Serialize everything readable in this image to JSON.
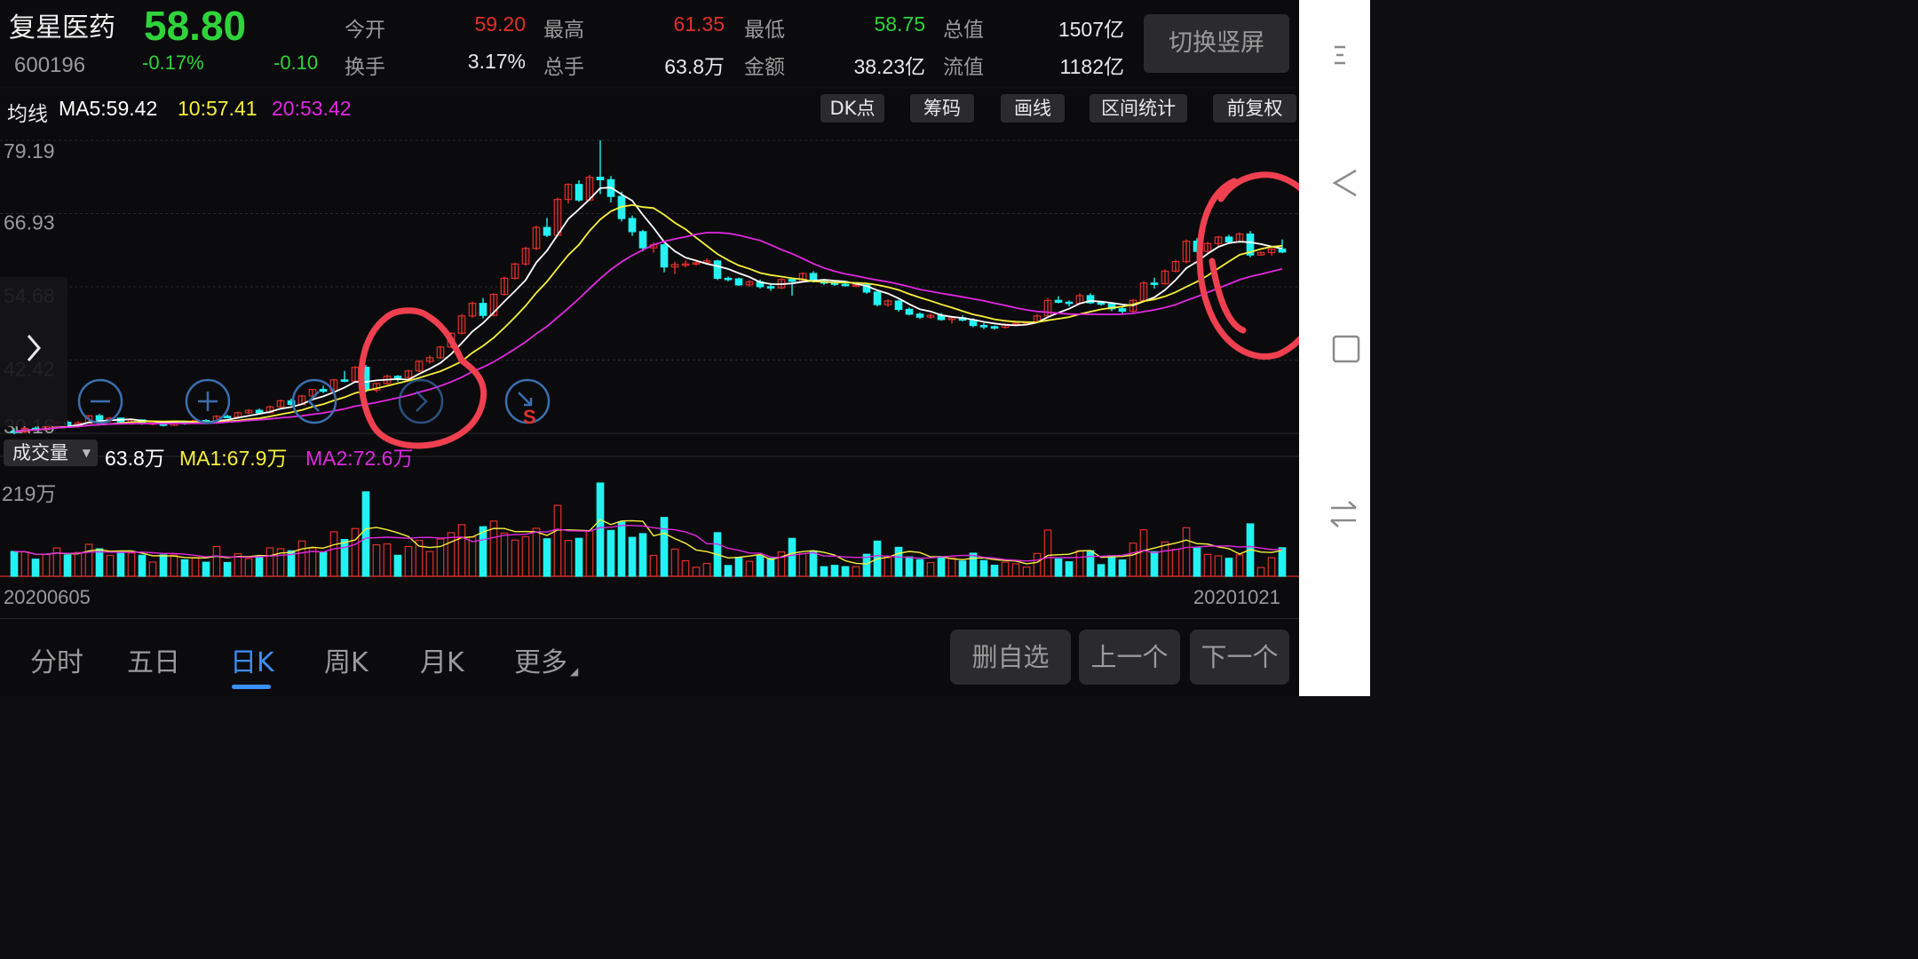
{
  "quote": {
    "name": "复星医药",
    "code": "600196",
    "price": "58.80",
    "pct_change": "-0.17%",
    "abs_change": "-0.10",
    "fields": [
      {
        "label": "今开",
        "value": "59.20",
        "color": "#e0302a"
      },
      {
        "label": "最高",
        "value": "61.35",
        "color": "#e0302a"
      },
      {
        "label": "最低",
        "value": "58.75",
        "color": "#2fd43b"
      },
      {
        "label": "总值",
        "value": "1507亿",
        "color": "#e8e8e8"
      },
      {
        "label": "换手",
        "value": "3.17%",
        "color": "#e8e8e8"
      },
      {
        "label": "总手",
        "value": "63.8万",
        "color": "#e8e8e8"
      },
      {
        "label": "金额",
        "value": "38.23亿",
        "color": "#e8e8e8"
      },
      {
        "label": "流值",
        "value": "1182亿",
        "color": "#e8e8e8"
      }
    ],
    "switch_label": "切换竖屏"
  },
  "ma_bar": {
    "label": "均线",
    "ma5": "MA5:59.42",
    "ma10": "10:57.41",
    "ma20": "20:53.42",
    "buttons": [
      "DK点",
      "筹码",
      "画线",
      "区间统计",
      "前复权"
    ]
  },
  "price_axis": [
    "79.19",
    "66.93",
    "54.68",
    "42.42",
    "30.16"
  ],
  "volume": {
    "selector": "成交量",
    "value": "63.8万",
    "ma1": "MA1:67.9万",
    "ma2": "MA2:72.6万",
    "axis_max": "219万"
  },
  "dates": {
    "start": "20200605",
    "end": "20201021"
  },
  "tabs": [
    "分时",
    "五日",
    "日K",
    "周K",
    "月K",
    "更多"
  ],
  "active_tab": "日K",
  "actions": [
    "删自选",
    "上一个",
    "下一个"
  ],
  "icons": [
    "expand-chevron-icon",
    "zoom-out-icon",
    "zoom-in-icon",
    "scroll-left-icon",
    "scroll-right-icon",
    "reset-icon",
    "menu-icon",
    "back-icon",
    "home-icon",
    "switch-app-icon"
  ],
  "colors": {
    "up": "#e0302a",
    "down": "#22f2f2",
    "ma5": "#ffffff",
    "ma10": "#f7f03a",
    "ma20": "#e028e0",
    "annotation": "#f04050"
  },
  "chart_data": {
    "type": "candlestick",
    "ylim": [
      30.16,
      79.19
    ],
    "candles": [
      [
        30.5,
        31.0,
        30.0,
        30.4
      ],
      [
        30.4,
        31.2,
        30.2,
        31.0
      ],
      [
        31.0,
        31.3,
        30.6,
        30.8
      ],
      [
        30.8,
        31.5,
        30.6,
        31.3
      ],
      [
        31.3,
        32.2,
        31.0,
        32.0
      ],
      [
        32.0,
        32.3,
        31.4,
        31.6
      ],
      [
        31.6,
        32.2,
        31.2,
        31.9
      ],
      [
        31.9,
        33.2,
        31.8,
        33.1
      ],
      [
        33.1,
        33.4,
        32.2,
        32.4
      ],
      [
        32.4,
        32.9,
        32.0,
        32.7
      ],
      [
        32.7,
        32.8,
        31.8,
        32.0
      ],
      [
        32.0,
        32.6,
        31.6,
        32.4
      ],
      [
        32.4,
        32.5,
        31.6,
        31.8
      ],
      [
        31.8,
        32.1,
        31.5,
        31.9
      ],
      [
        31.9,
        32.2,
        31.3,
        31.5
      ],
      [
        31.5,
        32.3,
        31.4,
        32.1
      ],
      [
        32.1,
        32.3,
        31.6,
        31.8
      ],
      [
        31.8,
        32.5,
        31.7,
        32.3
      ],
      [
        32.3,
        32.5,
        31.9,
        32.0
      ],
      [
        32.0,
        33.2,
        31.9,
        33.0
      ],
      [
        33.0,
        33.3,
        32.7,
        32.9
      ],
      [
        32.9,
        33.8,
        32.8,
        33.6
      ],
      [
        33.6,
        34.2,
        33.4,
        34.0
      ],
      [
        34.0,
        34.3,
        33.4,
        33.6
      ],
      [
        33.6,
        34.8,
        33.5,
        34.6
      ],
      [
        34.6,
        35.8,
        34.5,
        35.6
      ],
      [
        35.6,
        36.0,
        34.8,
        35.0
      ],
      [
        35.0,
        36.6,
        34.9,
        36.4
      ],
      [
        36.4,
        37.6,
        36.2,
        37.5
      ],
      [
        37.5,
        38.1,
        36.9,
        37.2
      ],
      [
        37.2,
        39.3,
        37.0,
        39.1
      ],
      [
        39.1,
        40.6,
        38.7,
        38.9
      ],
      [
        38.9,
        41.4,
        38.8,
        41.2
      ],
      [
        41.2,
        41.6,
        37.0,
        37.4
      ],
      [
        37.4,
        38.6,
        37.0,
        38.5
      ],
      [
        38.5,
        40.0,
        38.3,
        39.7
      ],
      [
        39.7,
        39.9,
        38.8,
        39.5
      ],
      [
        39.5,
        40.8,
        39.2,
        40.6
      ],
      [
        40.6,
        42.4,
        40.4,
        42.2
      ],
      [
        42.2,
        43.2,
        41.8,
        42.8
      ],
      [
        42.8,
        44.8,
        42.6,
        44.6
      ],
      [
        44.6,
        47.1,
        44.4,
        46.9
      ],
      [
        46.9,
        50.1,
        46.7,
        49.8
      ],
      [
        49.8,
        52.2,
        49.5,
        51.9
      ],
      [
        51.9,
        52.8,
        49.4,
        49.9
      ],
      [
        49.9,
        53.6,
        49.7,
        53.4
      ],
      [
        53.4,
        56.4,
        53.2,
        56.1
      ],
      [
        56.1,
        58.7,
        55.9,
        58.5
      ],
      [
        58.5,
        61.4,
        58.2,
        61.1
      ],
      [
        61.1,
        64.9,
        60.8,
        64.6
      ],
      [
        64.6,
        66.2,
        63.0,
        63.3
      ],
      [
        63.3,
        69.6,
        63.1,
        69.3
      ],
      [
        69.3,
        72.0,
        68.6,
        71.8
      ],
      [
        71.8,
        72.5,
        68.9,
        69.2
      ],
      [
        69.2,
        73.4,
        69.0,
        73.0
      ],
      [
        73.0,
        79.2,
        70.2,
        72.6
      ],
      [
        72.6,
        73.2,
        68.8,
        69.8
      ],
      [
        69.8,
        70.6,
        65.6,
        66.1
      ],
      [
        66.1,
        66.6,
        63.2,
        63.9
      ],
      [
        63.9,
        64.2,
        60.6,
        61.2
      ],
      [
        61.2,
        62.1,
        60.4,
        61.7
      ],
      [
        61.7,
        61.9,
        57.1,
        58.0
      ],
      [
        58.0,
        58.9,
        56.8,
        58.4
      ],
      [
        58.4,
        59.1,
        57.9,
        58.5
      ],
      [
        58.5,
        58.9,
        58.2,
        58.7
      ],
      [
        58.7,
        59.4,
        58.4,
        59.0
      ],
      [
        59.0,
        59.2,
        55.8,
        56.1
      ],
      [
        56.1,
        56.4,
        55.6,
        56.0
      ],
      [
        56.0,
        56.2,
        54.8,
        55.0
      ],
      [
        55.0,
        55.8,
        54.7,
        55.5
      ],
      [
        55.5,
        55.9,
        54.4,
        54.7
      ],
      [
        54.7,
        55.3,
        54.0,
        54.5
      ],
      [
        54.5,
        56.1,
        54.3,
        55.9
      ],
      [
        55.9,
        56.0,
        53.2,
        55.6
      ],
      [
        55.6,
        57.1,
        55.4,
        56.9
      ],
      [
        56.9,
        57.3,
        55.4,
        55.6
      ],
      [
        55.6,
        55.7,
        55.0,
        55.3
      ],
      [
        55.3,
        55.6,
        54.8,
        55.1
      ],
      [
        55.1,
        55.4,
        54.7,
        54.9
      ],
      [
        54.9,
        55.3,
        54.6,
        55.0
      ],
      [
        55.0,
        55.1,
        53.5,
        53.8
      ],
      [
        53.8,
        53.9,
        51.4,
        51.7
      ],
      [
        51.7,
        52.6,
        51.3,
        52.3
      ],
      [
        52.3,
        52.5,
        50.5,
        50.9
      ],
      [
        50.9,
        51.2,
        49.9,
        50.1
      ],
      [
        50.1,
        50.4,
        49.3,
        49.6
      ],
      [
        49.6,
        50.2,
        49.3,
        49.9
      ],
      [
        49.9,
        50.3,
        49.0,
        49.2
      ],
      [
        49.2,
        49.7,
        48.5,
        49.5
      ],
      [
        49.5,
        49.9,
        48.9,
        49.1
      ],
      [
        49.1,
        49.4,
        47.9,
        48.2
      ],
      [
        48.2,
        48.6,
        47.6,
        48.0
      ],
      [
        48.0,
        48.2,
        47.5,
        47.9
      ],
      [
        47.9,
        48.6,
        47.7,
        48.4
      ],
      [
        48.4,
        48.9,
        48.1,
        48.6
      ],
      [
        48.6,
        48.9,
        48.3,
        48.8
      ],
      [
        48.8,
        50.1,
        48.6,
        49.8
      ],
      [
        49.8,
        52.8,
        49.6,
        52.4
      ],
      [
        52.4,
        53.1,
        51.9,
        52.1
      ],
      [
        52.1,
        52.4,
        51.4,
        51.9
      ],
      [
        51.9,
        53.6,
        51.8,
        53.2
      ],
      [
        53.2,
        53.6,
        51.8,
        52.0
      ],
      [
        52.0,
        52.3,
        51.5,
        51.8
      ],
      [
        51.8,
        52.0,
        50.6,
        51.0
      ],
      [
        51.0,
        51.3,
        50.2,
        50.6
      ],
      [
        50.6,
        52.6,
        50.3,
        52.4
      ],
      [
        52.4,
        55.6,
        52.2,
        55.3
      ],
      [
        55.3,
        56.2,
        54.4,
        55.2
      ],
      [
        55.2,
        57.6,
        55.0,
        57.3
      ],
      [
        57.3,
        59.2,
        57.1,
        58.9
      ],
      [
        58.9,
        62.6,
        58.6,
        62.3
      ],
      [
        62.3,
        62.8,
        60.4,
        60.6
      ],
      [
        60.6,
        62.2,
        60.4,
        61.9
      ],
      [
        61.9,
        63.2,
        61.5,
        63.0
      ],
      [
        63.0,
        63.4,
        61.9,
        62.2
      ],
      [
        62.2,
        63.8,
        62.0,
        63.5
      ],
      [
        63.5,
        64.0,
        59.6,
        60.0
      ],
      [
        60.0,
        60.6,
        59.9,
        60.4
      ],
      [
        60.4,
        61.4,
        59.9,
        61.0
      ],
      [
        61.0,
        62.6,
        60.3,
        60.5
      ]
    ],
    "volume_max": 219
  }
}
